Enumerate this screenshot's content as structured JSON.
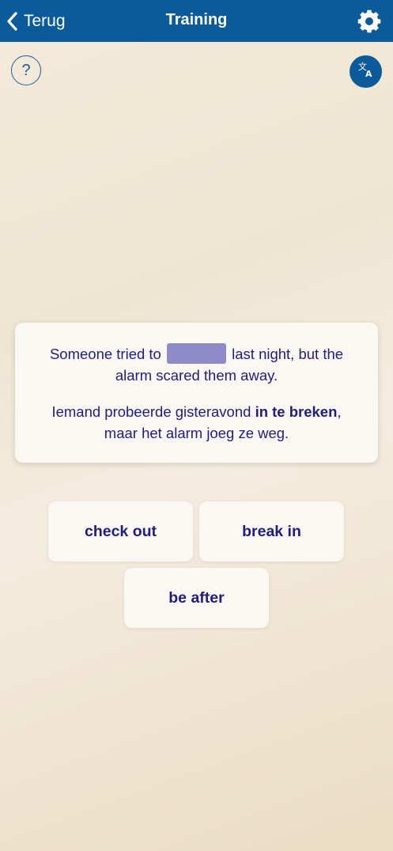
{
  "header": {
    "back_label": "Terug",
    "title": "Training",
    "background": "#0b5a99"
  },
  "help_button": {
    "label": "?"
  },
  "exercise": {
    "en_before": "Someone tried to",
    "en_after": "last night, but the alarm scared them away.",
    "nl_before": "Iemand probeerde gisteravond",
    "nl_highlight": "in te breken",
    "nl_after": ", maar het alarm joeg ze weg.",
    "text_color": "#1f1d80",
    "blank_color": "#8f8bc9"
  },
  "options": [
    {
      "label": "check out"
    },
    {
      "label": "break in"
    },
    {
      "label": "be after"
    }
  ],
  "icons": {
    "back": "chevron-left-icon",
    "settings": "gear-icon",
    "translate": "translate-icon",
    "help": "question-icon"
  }
}
